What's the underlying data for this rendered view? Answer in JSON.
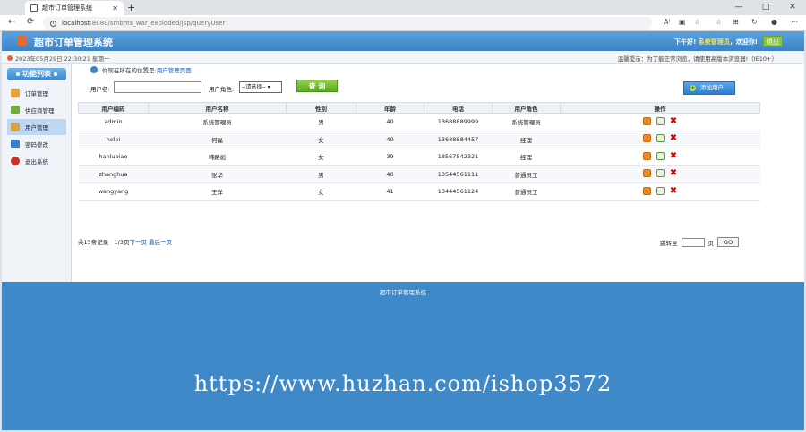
{
  "browser": {
    "tab_title": "超市订单管理系统",
    "tab_close": "✕",
    "new_tab": "+",
    "controls": [
      "—",
      "□",
      "✕"
    ],
    "back": "←",
    "reload": "⟳",
    "url_host": "localhost",
    "url_rest": ":8080/smbms_war_exploded/jsp/queryUser",
    "toolbar_icons": [
      "A⁾",
      "▣",
      "☆",
      "☆",
      "⊞",
      "↻",
      "●",
      "⋯"
    ]
  },
  "header": {
    "title": "超市订单管理系统",
    "greet_prefix": "下午好!",
    "username": "系统管理员",
    "greet_suffix": "，欢迎你!",
    "logout": "退出"
  },
  "infobar": {
    "datetime": "2023年05月29日 22:30:21 星期一",
    "tip": "温馨提示：为了能正常浏览，请使用高版本浏览器!（IE10+）"
  },
  "sidebar": {
    "title": "功能列表",
    "items": [
      {
        "label": "订单管理",
        "color": "#e9a23b"
      },
      {
        "label": "供应商管理",
        "color": "#6fae3c"
      },
      {
        "label": "用户管理",
        "color": "#d9a14a"
      },
      {
        "label": "密码修改",
        "color": "#3a7fc8"
      },
      {
        "label": "退出系统",
        "color": "#c8302a"
      }
    ]
  },
  "breadcrumb": {
    "prefix": "你现在所在的位置是:",
    "current": "用户管理页面"
  },
  "filter": {
    "username_label": "用户名:",
    "username_value": "",
    "role_label": "用户角色:",
    "role_selected": "--请选择--",
    "query_button": "查 询",
    "add_button": "添加用户"
  },
  "table": {
    "headers": [
      "用户编码",
      "用户名称",
      "性别",
      "年龄",
      "电话",
      "用户角色",
      "操作"
    ],
    "rows": [
      [
        "admin",
        "系统管理员",
        "男",
        "40",
        "13688889999",
        "系统管理员"
      ],
      [
        "helei",
        "何磊",
        "女",
        "40",
        "13688884457",
        "经理"
      ],
      [
        "hanlubiao",
        "韩路彪",
        "女",
        "39",
        "18567542321",
        "经理"
      ],
      [
        "zhanghua",
        "张华",
        "男",
        "40",
        "13544561111",
        "普通员工"
      ],
      [
        "wangyang",
        "王洋",
        "女",
        "41",
        "13444561124",
        "普通员工"
      ]
    ]
  },
  "pager": {
    "total": "共13条记录",
    "pages": "1/3页",
    "next": "下一页",
    "last": "最后一页",
    "jump_label": "跳转至",
    "jump_unit": "页",
    "go": "GO"
  },
  "footer": {
    "text": "超市订单管理系统",
    "watermark": "https://www.huzhan.com/ishop3572"
  },
  "colors": {
    "header_blue": "#3b82c6",
    "footer_blue": "#3f89c9",
    "logout_green": "#8cc63f",
    "delete_red": "#d40000"
  }
}
